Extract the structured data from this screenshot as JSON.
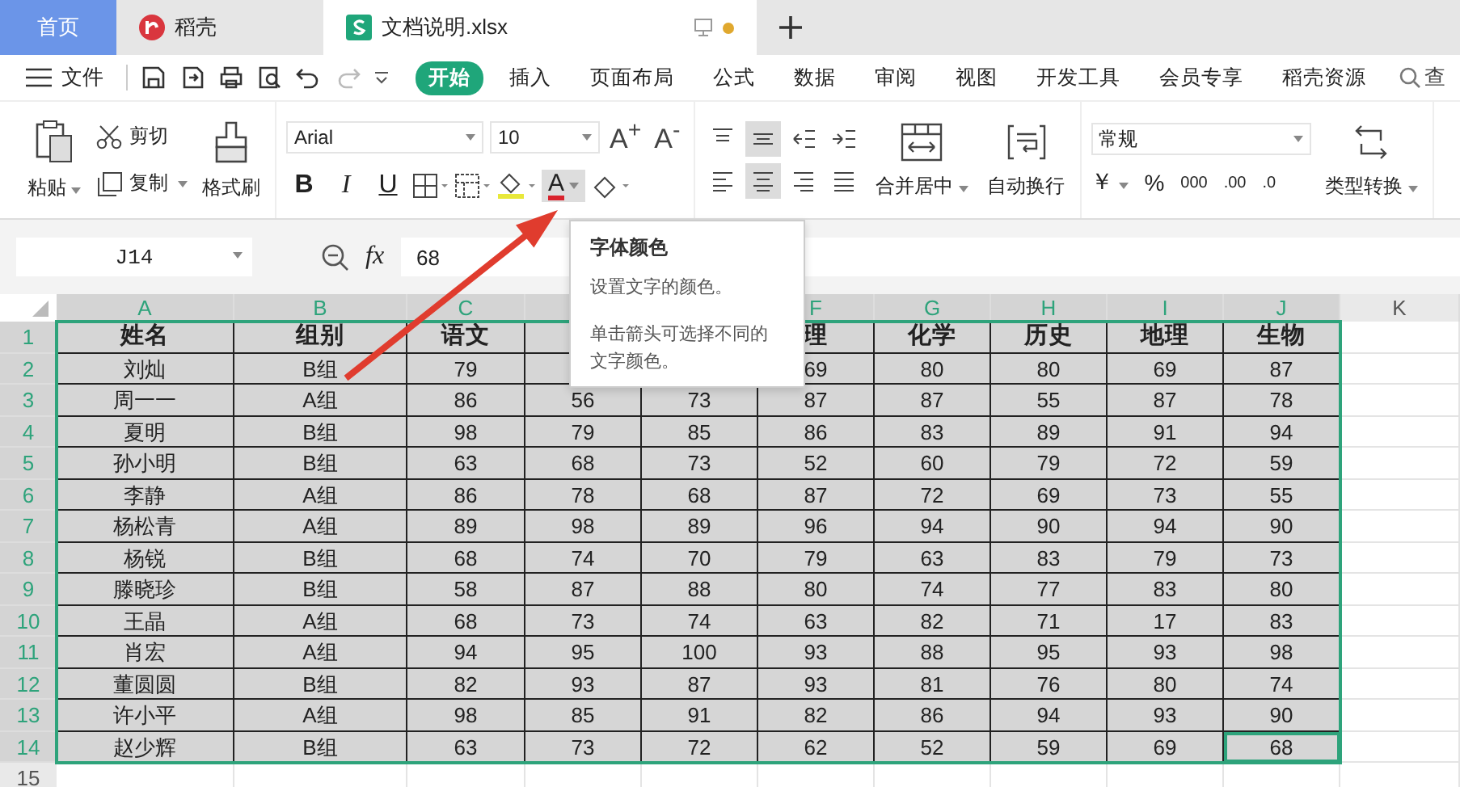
{
  "tabs": [
    {
      "label": "首页",
      "kind": "home",
      "selected": false
    },
    {
      "label": "稻壳",
      "kind": "docer",
      "selected": false
    },
    {
      "label": "文档说明.xlsx",
      "kind": "sheet",
      "selected": true
    }
  ],
  "menu": {
    "file": "文件",
    "items": [
      {
        "label": "开始",
        "selected": true
      },
      {
        "label": "插入",
        "selected": false
      },
      {
        "label": "页面布局",
        "selected": false
      },
      {
        "label": "公式",
        "selected": false
      },
      {
        "label": "数据",
        "selected": false
      },
      {
        "label": "审阅",
        "selected": false
      },
      {
        "label": "视图",
        "selected": false
      },
      {
        "label": "开发工具",
        "selected": false
      },
      {
        "label": "会员专享",
        "selected": false
      },
      {
        "label": "稻壳资源",
        "selected": false
      }
    ],
    "search": "查"
  },
  "ribbon": {
    "paste": "粘贴",
    "cut": "剪切",
    "copy": "复制",
    "format_painter": "格式刷",
    "font": "Arial",
    "font_size": "10",
    "grow": "A$^{+}$",
    "shrink": "A$^{-}$",
    "styles": [
      "B",
      "I",
      "U"
    ],
    "font_color": "A",
    "align": [
      {
        "kind": "top",
        "selected": false
      },
      {
        "kind": "middle",
        "selected": true
      },
      {
        "kind": "outdent",
        "selected": false
      },
      {
        "kind": "indent",
        "selected": false
      },
      {
        "kind": "left",
        "selected": false
      },
      {
        "kind": "center",
        "selected": true
      },
      {
        "kind": "right",
        "selected": false
      },
      {
        "kind": "justify",
        "selected": false
      }
    ],
    "merge": "合并居中",
    "wrap": "自动换行",
    "number_format": "常规",
    "currency": "￥",
    "percent": "%",
    "thousands": "000",
    "decimal_more": ".00",
    "decimal_less": ".0",
    "convert": "类型转换"
  },
  "formula_bar": {
    "cell": "J14",
    "fx": "fx",
    "value": "68"
  },
  "tooltip": {
    "title": "字体颜色",
    "text": "设置文字的颜色。",
    "hint": "单击箭头可选择不同的文字颜色。"
  },
  "sheet": {
    "columns": [
      {
        "label": "A",
        "selected": true
      },
      {
        "label": "B",
        "selected": true
      },
      {
        "label": "C",
        "selected": true
      },
      {},
      {},
      {
        "label": "F",
        "selected": true
      },
      {
        "label": "G",
        "selected": true
      },
      {
        "label": "H",
        "selected": true
      },
      {
        "label": "I",
        "selected": true
      },
      {
        "label": "J",
        "selected": true
      },
      {
        "label": "K",
        "selected": false
      }
    ],
    "rows": [
      {
        "num": "1",
        "selected": true,
        "kind": "header",
        "cells": [
          "姓名",
          "组别",
          "语文",
          null,
          null,
          "理",
          "化学",
          "历史",
          "地理",
          "生物"
        ]
      },
      {
        "num": "2",
        "selected": true,
        "kind": "data",
        "cells": [
          "刘灿",
          "B组",
          "79",
          null,
          null,
          "69",
          "80",
          "80",
          "69",
          "87"
        ]
      },
      {
        "num": "3",
        "selected": true,
        "kind": "data",
        "cells": [
          "周一一",
          "A组",
          "86",
          "56",
          "73",
          "87",
          "87",
          "55",
          "87",
          "78"
        ]
      },
      {
        "num": "4",
        "selected": true,
        "kind": "data",
        "cells": [
          "夏明",
          "B组",
          "98",
          "79",
          "85",
          "86",
          "83",
          "89",
          "91",
          "94"
        ]
      },
      {
        "num": "5",
        "selected": true,
        "kind": "data",
        "cells": [
          "孙小明",
          "B组",
          "63",
          "68",
          "73",
          "52",
          "60",
          "79",
          "72",
          "59"
        ]
      },
      {
        "num": "6",
        "selected": true,
        "kind": "data",
        "cells": [
          "李静",
          "A组",
          "86",
          "78",
          "68",
          "87",
          "72",
          "69",
          "73",
          "55"
        ]
      },
      {
        "num": "7",
        "selected": true,
        "kind": "data",
        "cells": [
          "杨松青",
          "A组",
          "89",
          "98",
          "89",
          "96",
          "94",
          "90",
          "94",
          "90"
        ]
      },
      {
        "num": "8",
        "selected": true,
        "kind": "data",
        "cells": [
          "杨锐",
          "B组",
          "68",
          "74",
          "70",
          "79",
          "63",
          "83",
          "79",
          "73"
        ]
      },
      {
        "num": "9",
        "selected": true,
        "kind": "data",
        "cells": [
          "滕晓珍",
          "B组",
          "58",
          "87",
          "88",
          "80",
          "74",
          "77",
          "83",
          "80"
        ]
      },
      {
        "num": "10",
        "selected": true,
        "kind": "data",
        "cells": [
          "王晶",
          "A组",
          "68",
          "73",
          "74",
          "63",
          "82",
          "71",
          "17",
          "83"
        ]
      },
      {
        "num": "11",
        "selected": true,
        "kind": "data",
        "cells": [
          "肖宏",
          "A组",
          "94",
          "95",
          "100",
          "93",
          "88",
          "95",
          "93",
          "98"
        ]
      },
      {
        "num": "12",
        "selected": true,
        "kind": "data",
        "cells": [
          "董圆圆",
          "B组",
          "82",
          "93",
          "87",
          "93",
          "81",
          "76",
          "80",
          "74"
        ]
      },
      {
        "num": "13",
        "selected": true,
        "kind": "data",
        "cells": [
          "许小平",
          "A组",
          "98",
          "85",
          "91",
          "82",
          "86",
          "94",
          "93",
          "90"
        ]
      },
      {
        "num": "14",
        "selected": true,
        "kind": "data",
        "cells": [
          "赵少辉",
          "B组",
          "63",
          "73",
          "72",
          "62",
          "52",
          "59",
          "69",
          "68"
        ]
      },
      {
        "num": "15",
        "selected": false,
        "kind": "empty"
      }
    ]
  }
}
